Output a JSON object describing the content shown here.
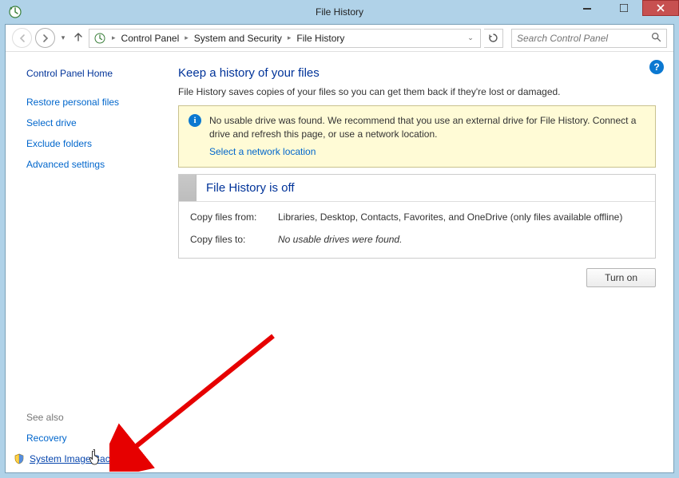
{
  "window": {
    "title": "File History"
  },
  "nav": {
    "breadcrumb": [
      "Control Panel",
      "System and Security",
      "File History"
    ],
    "search_placeholder": "Search Control Panel"
  },
  "sidebar": {
    "home": "Control Panel Home",
    "links": [
      "Restore personal files",
      "Select drive",
      "Exclude folders",
      "Advanced settings"
    ],
    "see_also_header": "See also",
    "see_also": [
      "Recovery",
      "System Image Backup"
    ]
  },
  "main": {
    "heading": "Keep a history of your files",
    "description": "File History saves copies of your files so you can get them back if they're lost or damaged.",
    "warning": {
      "text": "No usable drive was found. We recommend that you use an external drive for File History. Connect a drive and refresh this page, or use a network location.",
      "link": "Select a network location"
    },
    "status": {
      "title": "File History is off",
      "rows": [
        {
          "label": "Copy files from:",
          "value": "Libraries, Desktop, Contacts, Favorites, and OneDrive (only files available offline)",
          "italic": false
        },
        {
          "label": "Copy files to:",
          "value": "No usable drives were found.",
          "italic": true
        }
      ]
    },
    "turn_on": "Turn on"
  }
}
